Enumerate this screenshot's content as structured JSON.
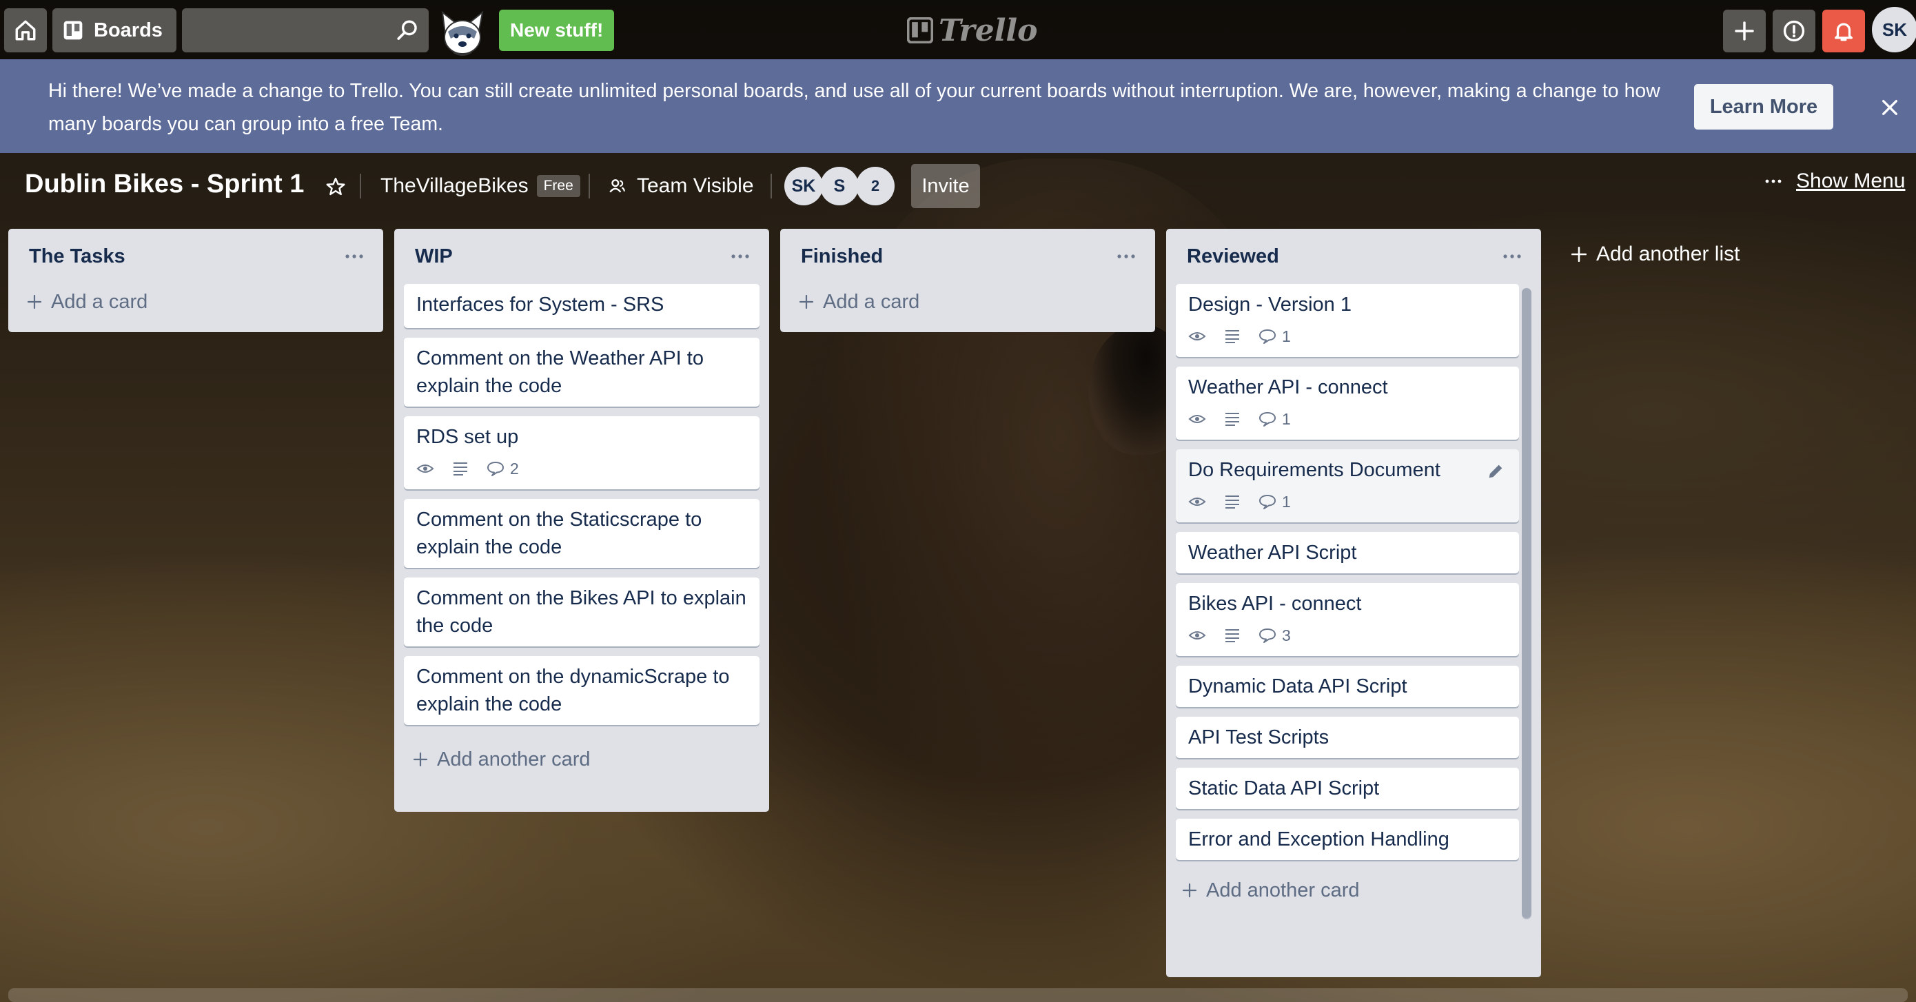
{
  "header": {
    "boards_label": "Boards",
    "search_placeholder": "",
    "new_stuff_label": "New stuff!",
    "logo_text": "Trello",
    "user_initials": "SK"
  },
  "banner": {
    "message": "Hi there! We’ve made a change to Trello. You can still create unlimited personal boards, and use all of your current boards without interruption. We are, however, making a change to how many boards you can group into a free Team.",
    "learn_more_label": "Learn More"
  },
  "board": {
    "title": "Dublin Bikes - Sprint 1",
    "team_name": "TheVillageBikes",
    "team_plan": "Free",
    "visibility": "Team Visible",
    "members": [
      "SK",
      "S"
    ],
    "member_overflow": "2",
    "invite_label": "Invite",
    "show_menu_label": "Show Menu",
    "add_list_label": "Add another list"
  },
  "lists": [
    {
      "title": "The Tasks",
      "cards": [],
      "add_label": "Add a card"
    },
    {
      "title": "WIP",
      "cards": [
        {
          "title": "Interfaces for System - SRS"
        },
        {
          "title": "Comment on the Weather API to explain the code"
        },
        {
          "title": "RDS set up",
          "comments": "2"
        },
        {
          "title": "Comment on the Staticscrape to explain the code"
        },
        {
          "title": "Comment on the Bikes API to explain the code"
        },
        {
          "title": "Comment on the dynamicScrape to explain the code"
        }
      ],
      "add_label": "Add another card"
    },
    {
      "title": "Finished",
      "cards": [],
      "add_label": "Add a card"
    },
    {
      "title": "Reviewed",
      "cards": [
        {
          "title": "Design - Version 1",
          "comments": "1"
        },
        {
          "title": "Weather API - connect",
          "comments": "1"
        },
        {
          "title": "Do Requirements Document",
          "comments": "1"
        },
        {
          "title": "Weather API Script"
        },
        {
          "title": "Bikes API - connect",
          "comments": "3"
        },
        {
          "title": "Dynamic Data API Script"
        },
        {
          "title": "API Test Scripts"
        },
        {
          "title": "Static Data API Script"
        },
        {
          "title": "Error and Exception Handling"
        }
      ],
      "add_label": "Add another card"
    }
  ],
  "colors": {
    "banner": "#5e6c99",
    "list_bg": "#dfe1e6",
    "new_stuff": "#61bd4f",
    "notification": "#eb5a46"
  },
  "icons": [
    "home-icon",
    "board-icon",
    "search-icon",
    "mascot-icon",
    "plus-icon",
    "info-icon",
    "bell-icon",
    "close-icon",
    "star-icon",
    "team-icon",
    "ellipsis-icon",
    "eye-icon",
    "description-icon",
    "comment-icon",
    "pencil-icon"
  ]
}
